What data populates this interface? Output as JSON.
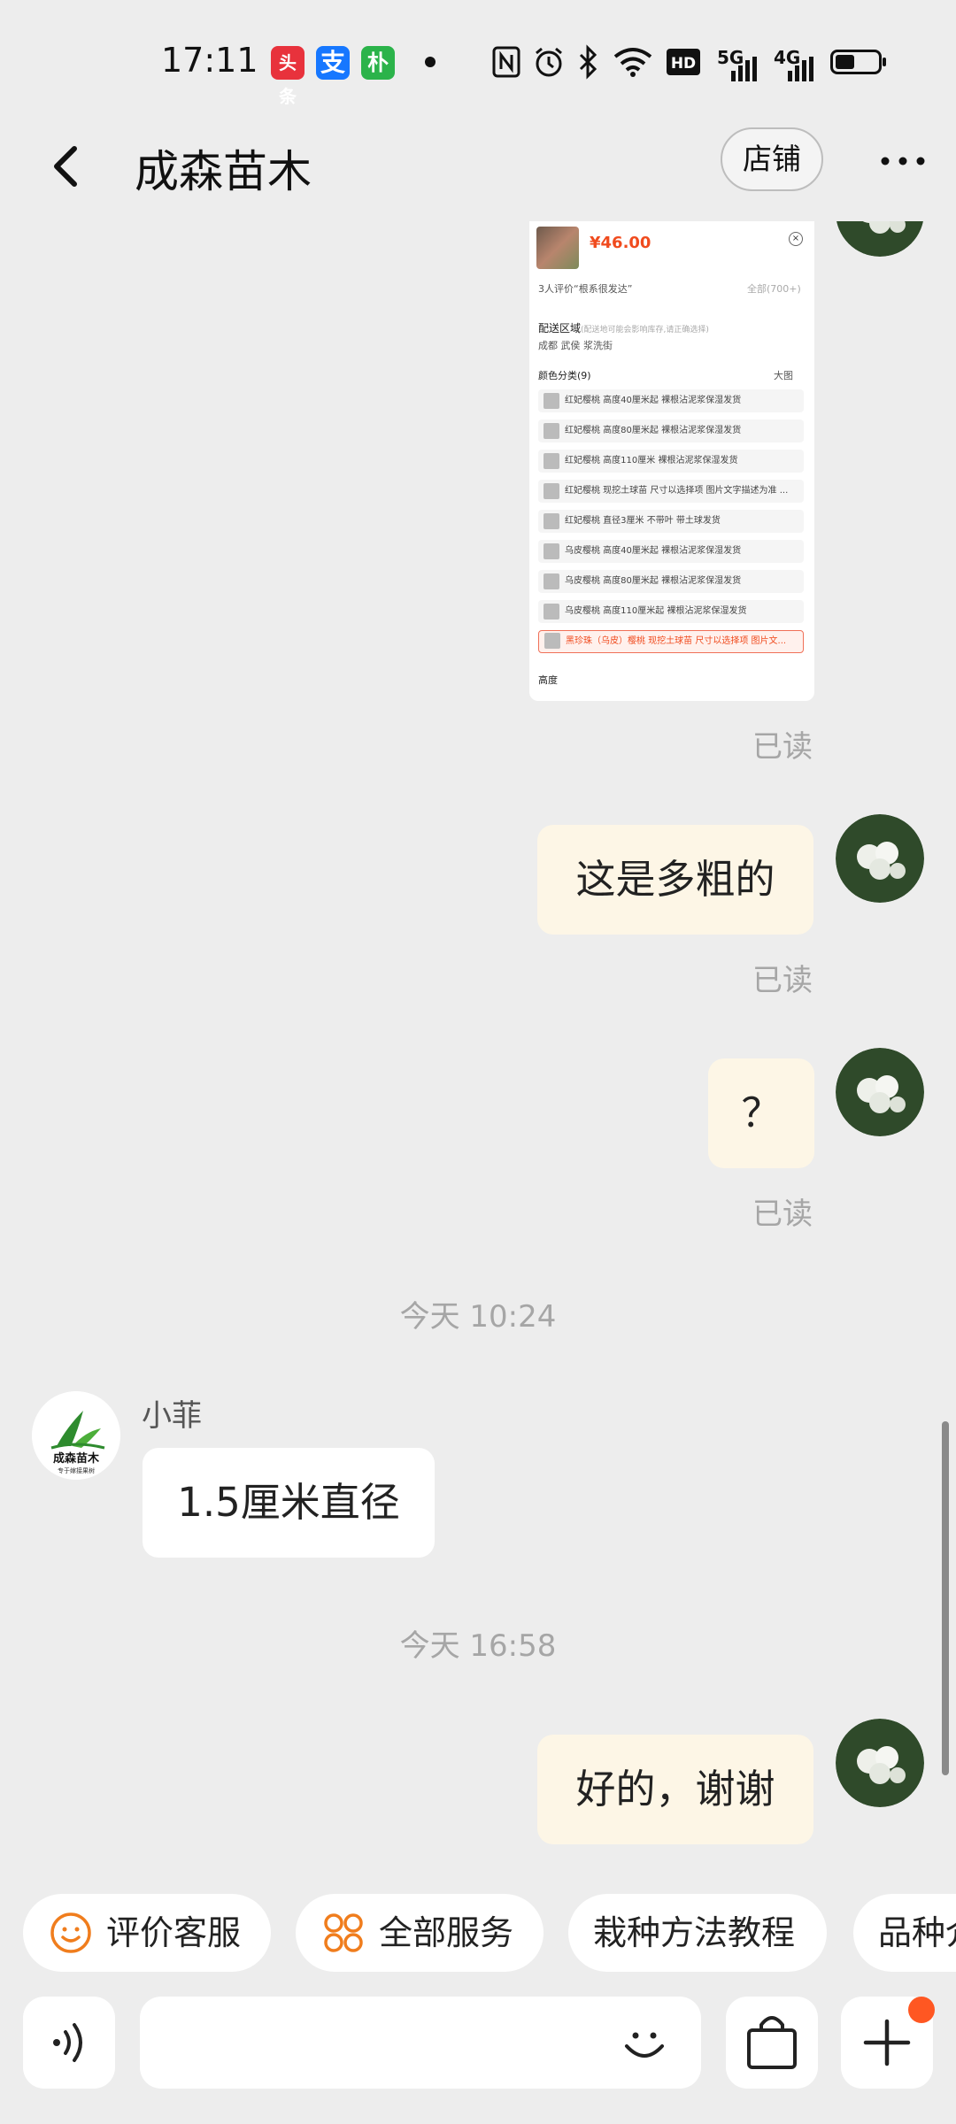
{
  "status_bar": {
    "time": "17:11",
    "app_icons": [
      {
        "label": "头条",
        "color": "#e8323c"
      },
      {
        "label": "支",
        "color": "#1677ff"
      },
      {
        "label": "朴",
        "color": "#2bb34a"
      }
    ],
    "network_labels": [
      "5G",
      "4G"
    ],
    "battery_level": 0.45
  },
  "header": {
    "title": "成森苗木",
    "shop_label": "店铺"
  },
  "product_card": {
    "price": "¥46.00",
    "review_line": "3人评价“根系很发达”",
    "review_all": "全部(700+)",
    "delivery_title": "配送区域",
    "delivery_note": "(配送地可能会影响库存,请正确选择)",
    "delivery_location": "成都 武侯 浆洗街",
    "color_title": "颜色分类(9)",
    "big_image_label": "大图",
    "options": [
      "红妃樱桃 高度40厘米起 裸根沾泥浆保湿发货",
      "红妃樱桃 高度80厘米起 裸根沾泥浆保湿发货",
      "红妃樱桃 高度110厘米 裸根沾泥浆保湿发货",
      "红妃樱桃 现挖土球苗 尺寸以选择项 图片文字描述为准 ...",
      "红妃樱桃 直径3厘米 不带叶 带土球发货",
      "乌皮樱桃 高度40厘米起 裸根沾泥浆保湿发货",
      "乌皮樱桃 高度80厘米起 裸根沾泥浆保湿发货",
      "乌皮樱桃 高度110厘米起 裸根沾泥浆保湿发货",
      "黑珍珠（乌皮）樱桃 现挖土球苗 尺寸以选择项 图片文..."
    ],
    "height_title": "高度"
  },
  "messages": {
    "read_label": "已读",
    "msg1": "这是多粗的",
    "msg2": "？",
    "timestamp1": "今天  10:24",
    "sender_name": "小菲",
    "shop_avatar_name": "成森苗木",
    "shop_avatar_tag": "专于嫁接果树",
    "msg3": "1.5厘米直径",
    "timestamp2": "今天  16:58",
    "msg4": "好的，谢谢"
  },
  "quick_replies": [
    "评价客服",
    "全部服务",
    "栽种方法教程",
    "品种介"
  ],
  "icons": [
    "back-arrow",
    "more-dots",
    "smile",
    "grid",
    "voice",
    "emoji",
    "shopping-bag",
    "plus"
  ],
  "accent_color": "#ff5722"
}
